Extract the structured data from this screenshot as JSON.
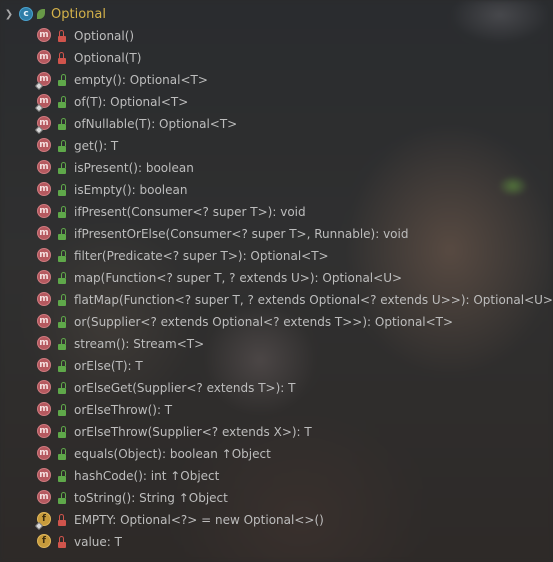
{
  "root": {
    "label": "Optional",
    "class_icon_letter": "c"
  },
  "members": [
    {
      "label": "Optional()",
      "kind": "method",
      "visibility": "private",
      "static": false
    },
    {
      "label": "Optional(T)",
      "kind": "method",
      "visibility": "private",
      "static": false
    },
    {
      "label": "empty(): Optional<T>",
      "kind": "method",
      "visibility": "public",
      "static": true
    },
    {
      "label": "of(T): Optional<T>",
      "kind": "method",
      "visibility": "public",
      "static": true
    },
    {
      "label": "ofNullable(T): Optional<T>",
      "kind": "method",
      "visibility": "public",
      "static": true
    },
    {
      "label": "get(): T",
      "kind": "method",
      "visibility": "public",
      "static": false
    },
    {
      "label": "isPresent(): boolean",
      "kind": "method",
      "visibility": "public",
      "static": false
    },
    {
      "label": "isEmpty(): boolean",
      "kind": "method",
      "visibility": "public",
      "static": false
    },
    {
      "label": "ifPresent(Consumer<? super T>): void",
      "kind": "method",
      "visibility": "public",
      "static": false
    },
    {
      "label": "ifPresentOrElse(Consumer<? super T>, Runnable): void",
      "kind": "method",
      "visibility": "public",
      "static": false
    },
    {
      "label": "filter(Predicate<? super T>): Optional<T>",
      "kind": "method",
      "visibility": "public",
      "static": false
    },
    {
      "label": "map(Function<? super T, ? extends U>): Optional<U>",
      "kind": "method",
      "visibility": "public",
      "static": false
    },
    {
      "label": "flatMap(Function<? super T, ? extends Optional<? extends U>>): Optional<U>",
      "kind": "method",
      "visibility": "public",
      "static": false
    },
    {
      "label": "or(Supplier<? extends Optional<? extends T>>): Optional<T>",
      "kind": "method",
      "visibility": "public",
      "static": false
    },
    {
      "label": "stream(): Stream<T>",
      "kind": "method",
      "visibility": "public",
      "static": false
    },
    {
      "label": "orElse(T): T",
      "kind": "method",
      "visibility": "public",
      "static": false
    },
    {
      "label": "orElseGet(Supplier<? extends T>): T",
      "kind": "method",
      "visibility": "public",
      "static": false
    },
    {
      "label": "orElseThrow(): T",
      "kind": "method",
      "visibility": "public",
      "static": false
    },
    {
      "label": "orElseThrow(Supplier<? extends X>): T",
      "kind": "method",
      "visibility": "public",
      "static": false
    },
    {
      "label": "equals(Object): boolean ↑Object",
      "kind": "method",
      "visibility": "public",
      "static": false
    },
    {
      "label": "hashCode(): int ↑Object",
      "kind": "method",
      "visibility": "public",
      "static": false
    },
    {
      "label": "toString(): String ↑Object",
      "kind": "method",
      "visibility": "public",
      "static": false
    },
    {
      "label": "EMPTY: Optional<?> = new Optional<>()",
      "kind": "field",
      "visibility": "private",
      "static": true
    },
    {
      "label": "value: T",
      "kind": "field",
      "visibility": "private",
      "static": false
    }
  ],
  "icons": {
    "method_letter": "m",
    "field_letter": "f"
  }
}
